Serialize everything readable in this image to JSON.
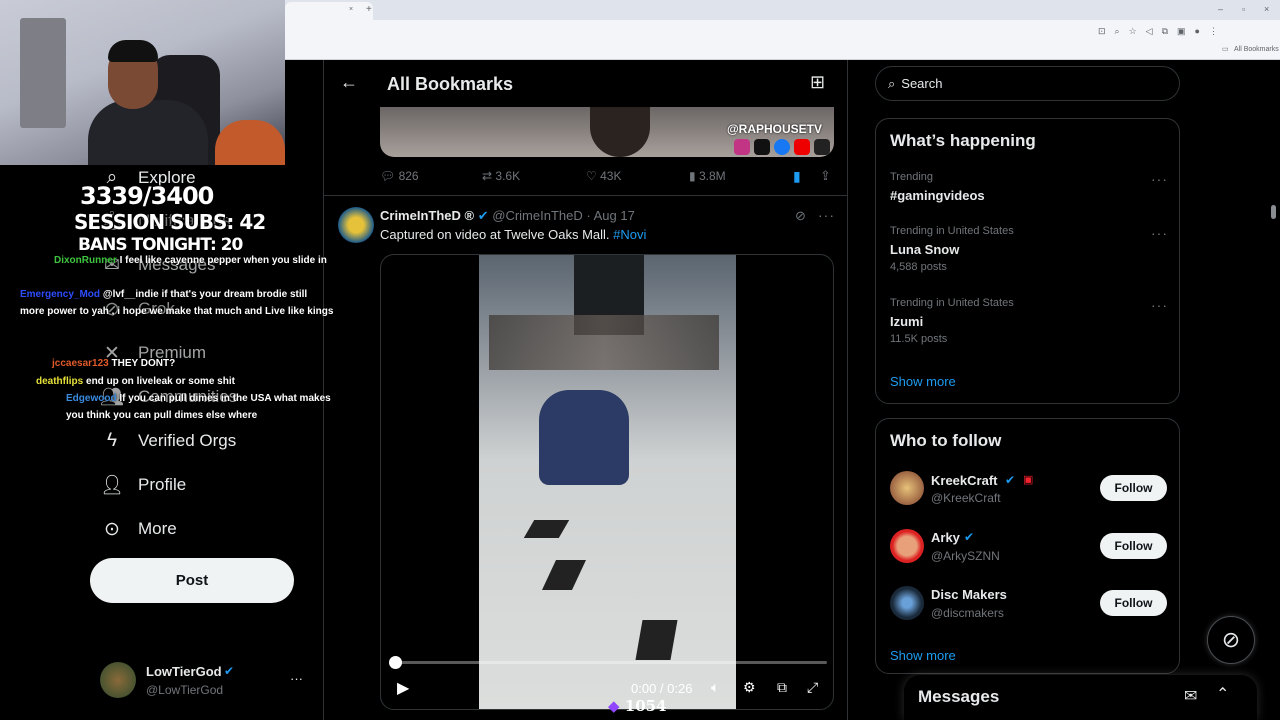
{
  "browser": {
    "tab_close": "×",
    "tab_add": "+",
    "all_bookmarks": "All Bookmarks"
  },
  "overlay": {
    "sub_count": "3339/3400",
    "session_subs": "SESSION SUBS: 42",
    "bans_tonight": "BANS TONIGHT: 20",
    "bits": "1054"
  },
  "nav": {
    "items": [
      {
        "label": "Explore",
        "icon": "search-icon"
      },
      {
        "label": "Notifications",
        "icon": "bell-icon"
      },
      {
        "label": "Messages",
        "icon": "mail-icon"
      },
      {
        "label": "Grok",
        "icon": "grok-icon"
      },
      {
        "label": "Premium",
        "icon": "x-logo-icon"
      },
      {
        "label": "Communities",
        "icon": "people-icon"
      },
      {
        "label": "Verified Orgs",
        "icon": "lightning-icon"
      },
      {
        "label": "Profile",
        "icon": "person-icon"
      },
      {
        "label": "More",
        "icon": "more-circle-icon"
      }
    ],
    "post_label": "Post",
    "account": {
      "name": "LowTierGod",
      "handle": "@LowTierGod"
    }
  },
  "chat": [
    {
      "user": "DixonRunner",
      "msg": "I feel like cayenne pepper when you slide in"
    },
    {
      "user": "Emergency_Mod",
      "msg": "@lvf__indie if that's your dream brodie still more power to yah , i hope we make that much and Live like kings"
    },
    {
      "user": "jccaesar123",
      "msg": "THEY DONT?"
    },
    {
      "user": "deathflips",
      "msg": "end up on liveleak or some shit"
    },
    {
      "user": "Edgewood",
      "msg": "If you can pull dimes in the USA what makes you think you can pull dimes else where"
    }
  ],
  "center": {
    "header_title": "All Bookmarks",
    "prev_tweet": {
      "watermark": "@RAPHOUSETV",
      "replies": "826",
      "reposts": "3.6K",
      "likes": "43K",
      "views": "3.8M"
    },
    "tweet": {
      "author": "CrimeInTheD ®",
      "handle": "@CrimeInTheD",
      "date": "· Aug 17",
      "text": "Captured on video at Twelve Oaks Mall.",
      "hashtag": "#Novi",
      "video_time": "0:00 / 0:26",
      "video_progress": 0
    }
  },
  "right": {
    "search_placeholder": "Search",
    "happening_title": "What’s happening",
    "trends": [
      {
        "context": "Trending",
        "name": "#gamingvideos",
        "posts": ""
      },
      {
        "context": "Trending in United States",
        "name": "Luna Snow",
        "posts": "4,588 posts"
      },
      {
        "context": "Trending in United States",
        "name": "Izumi",
        "posts": "11.5K posts"
      }
    ],
    "show_more": "Show more",
    "who_title": "Who to follow",
    "follow": [
      {
        "name": "KreekCraft",
        "handle": "@KreekCraft",
        "button": "Follow"
      },
      {
        "name": "Arky",
        "handle": "@ArkySZNN",
        "button": "Follow"
      },
      {
        "name": "Disc Makers",
        "handle": "@discmakers",
        "button": "Follow"
      }
    ],
    "show_more_2": "Show more",
    "messages_title": "Messages"
  },
  "colors": {
    "accent": "#1d9bf0",
    "background": "#000000",
    "border": "#2f3336"
  }
}
